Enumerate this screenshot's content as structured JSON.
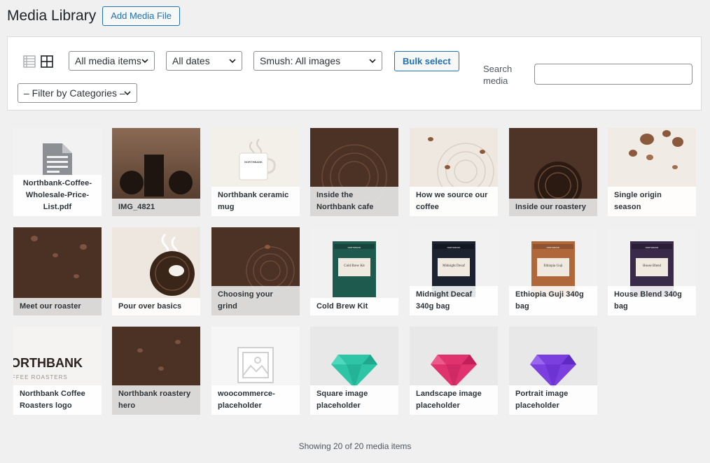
{
  "header": {
    "title": "Media Library",
    "add_button": "Add Media File"
  },
  "toolbar": {
    "filter_type": "All media items",
    "filter_dates": "All dates",
    "filter_smush": "Smush: All images",
    "bulk_select": "Bulk select",
    "filter_categories": "– Filter by Categories –",
    "search_label": "Search media",
    "search_value": ""
  },
  "items": [
    "Northbank-Coffee-Wholesale-Price-List.pdf",
    "IMG_4821",
    "Northbank ceramic mug",
    "Inside the Northbank cafe",
    "How we source our coffee",
    "Inside our roastery",
    "Single origin season",
    "Meet our roaster",
    "Pour over basics",
    "Choosing your grind",
    "Cold Brew Kit",
    "Midnight Decaf 340g bag",
    "Ethiopia Guji 340g bag",
    "House Blend 340g bag",
    "Northbank Coffee Roasters logo",
    "Northbank roastery hero",
    "woocommerce-placeholder",
    "Square image placeholder",
    "Landscape image placeholder",
    "Portrait image placeholder"
  ],
  "thumb_text": {
    "mug_brand": "NORTHBANK",
    "logo_main": "ORTHBANK",
    "logo_sub": "FFEE ROASTERS",
    "bag_brand": "NORTHBANK",
    "cold_brew_label": "Cold Brew Kit",
    "midnight_label": "Midnight Decaf",
    "ethiopia_label": "Ethiopia Guji",
    "house_label": "House Blend"
  },
  "status_text": "Showing 20 of 20 media items",
  "colors": {
    "accent": "#2271b1",
    "gem_teal": "#2ec4a6",
    "gem_pink": "#e0336e",
    "gem_purple": "#7b3fe0"
  }
}
